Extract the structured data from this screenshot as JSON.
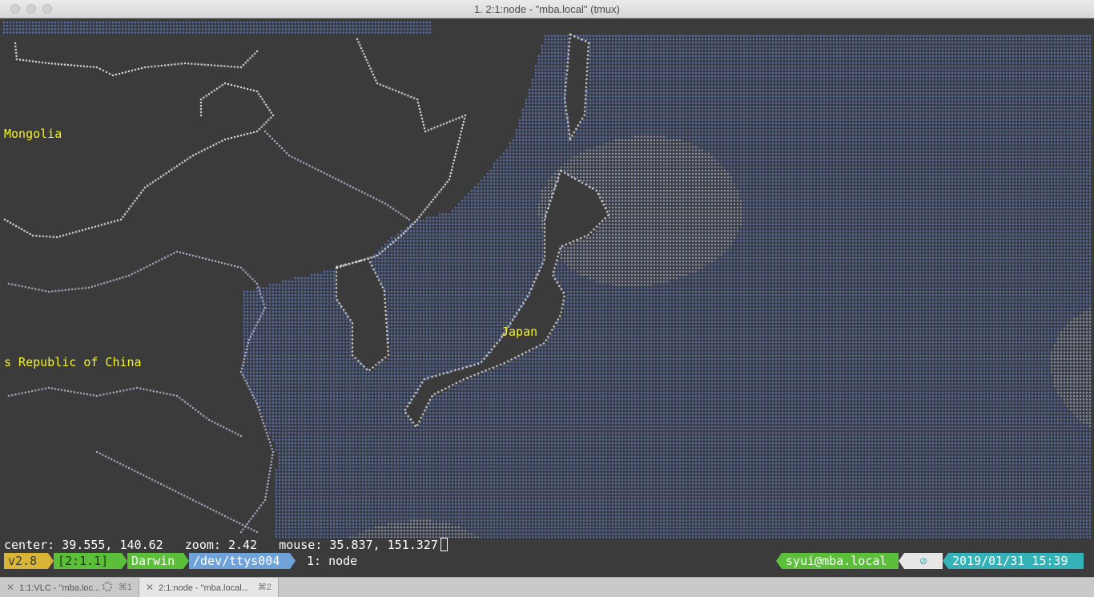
{
  "window": {
    "title": "1. 2:1:node - \"mba.local\"  (tmux)"
  },
  "map": {
    "labels": {
      "mongolia": "Mongolia",
      "china": "s Republic of China",
      "japan": "Japan"
    },
    "colors": {
      "ocean": "#5f7fd4",
      "ocean_light": "#9fb0dc",
      "land_border": "#c8c8e8",
      "coast": "#ffffff",
      "label": "#f3f32a"
    }
  },
  "command_line": {
    "center_label": "center:",
    "center_value": "39.555, 140.62",
    "zoom_label": "zoom:",
    "zoom_value": "2.42",
    "mouse_label": "mouse:",
    "mouse_value": "35.837, 151.327"
  },
  "status_bar": {
    "version": "v2.8",
    "session": "[2:1.1]",
    "os": "Darwin",
    "tty": "/dev/ttys004",
    "window_name": "1: node",
    "user_host": "syui@mba.local",
    "datetime": "2019/01/31 15:39",
    "colors": {
      "version": "#d8b437",
      "session": "#5bbf3a",
      "os": "#5bbf3a",
      "tty": "#6fa2d8",
      "user": "#5bbf3a",
      "icon": "#e6e6e6",
      "date": "#33b3b8"
    }
  },
  "tabs": [
    {
      "label": "1:1:VLC - \"mba.loc...",
      "shortcut": "⌘1",
      "active": false
    },
    {
      "label": "2:1:node - \"mba.local...",
      "shortcut": "⌘2",
      "active": true
    }
  ]
}
